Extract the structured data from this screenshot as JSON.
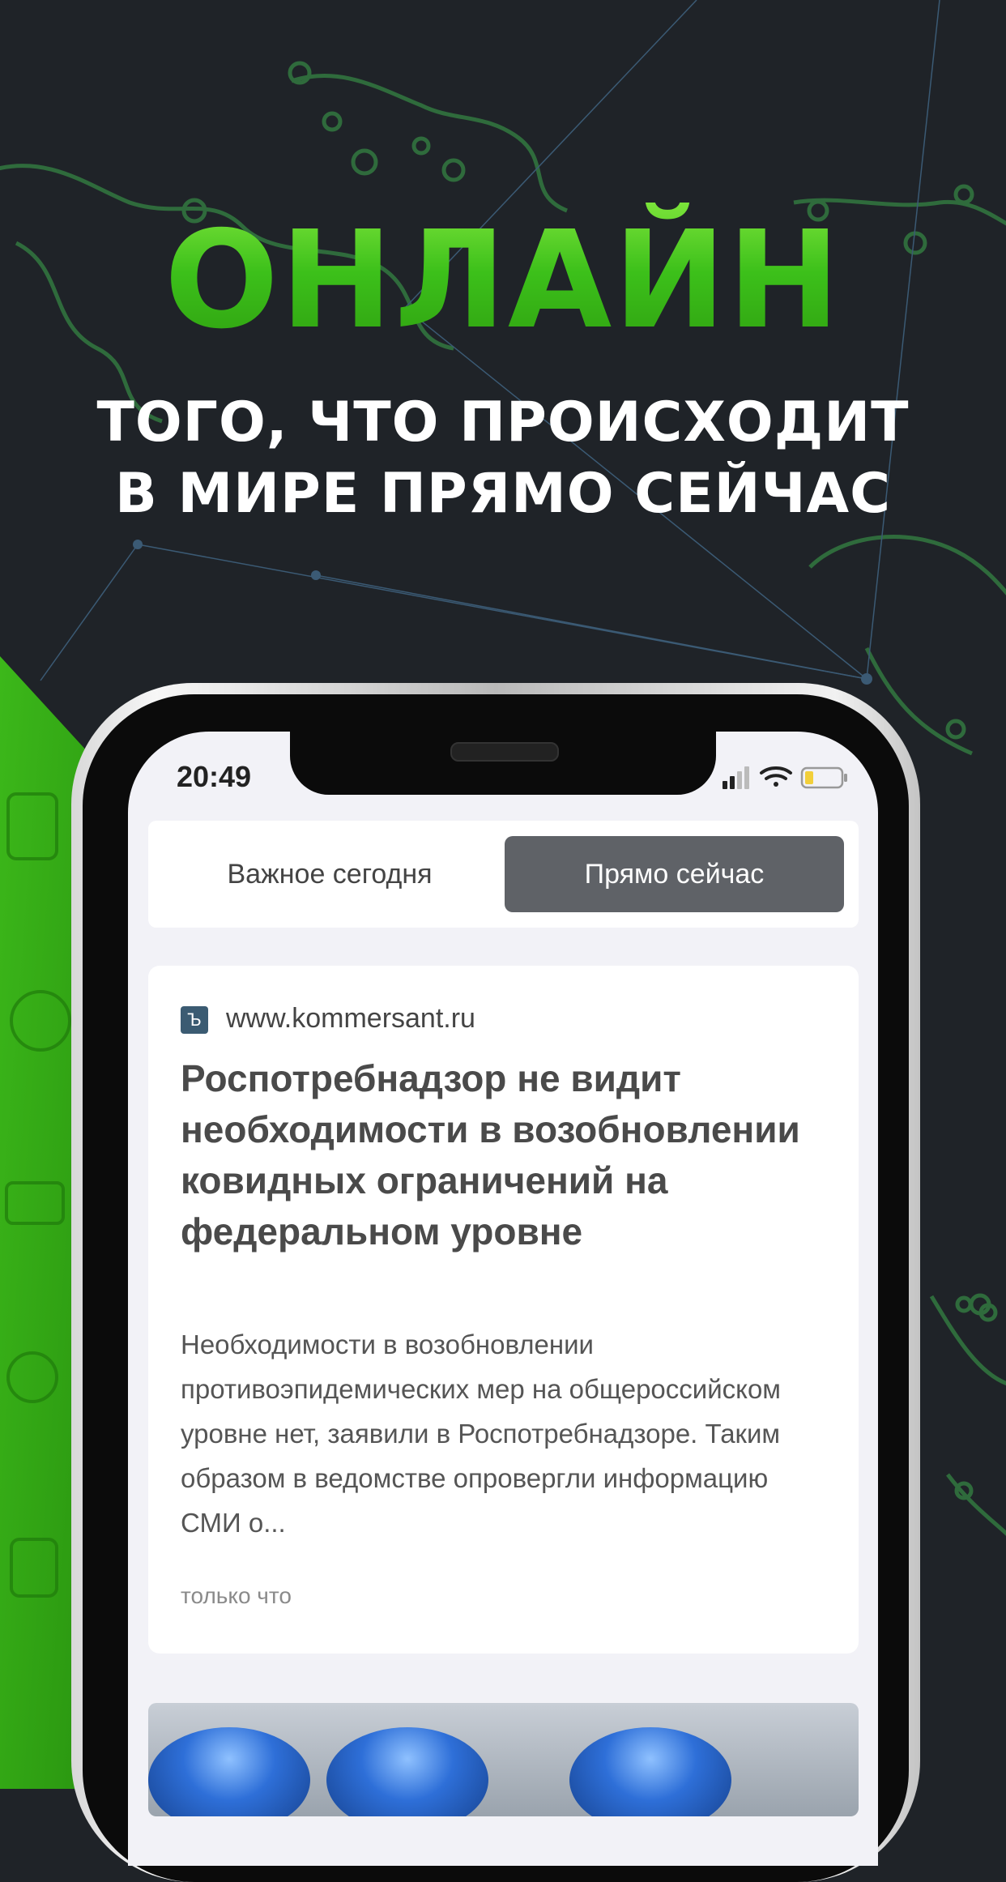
{
  "colors": {
    "accent_green": "#3ec51a",
    "background": "#1f2328",
    "map_lines": "#2f6b3c"
  },
  "promo": {
    "headline": "ОНЛАЙН",
    "subline_1": "ТОГО, ЧТО ПРОИСХОДИТ",
    "subline_2": "В МИРЕ ПРЯМО СЕЙЧАС"
  },
  "status_bar": {
    "time": "20:49",
    "icons": [
      "cellular-signal-icon",
      "wifi-icon",
      "battery-icon"
    ]
  },
  "tabs": [
    {
      "label": "Важное сегодня",
      "selected": false
    },
    {
      "label": "Прямо сейчас",
      "selected": true
    }
  ],
  "article": {
    "source_icon": "kommersant-logo-icon",
    "source": "www.kommersant.ru",
    "title": "Роспотребнадзор не видит необходимости в возобновлении ковидных ограничений на федеральном уровне",
    "summary": "Необходимости в возобновлении противоэпидемических мер на общероссийском уровне нет, заявили в Роспотребнадзоре. Таким образом в ведомстве опровергли информацию СМИ о...",
    "time": "только что"
  }
}
